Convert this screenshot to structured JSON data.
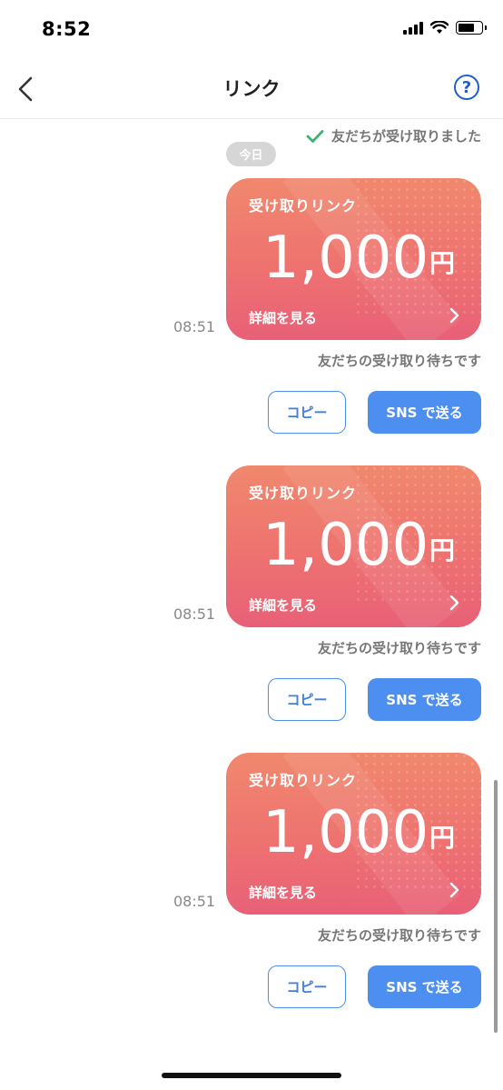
{
  "status_bar": {
    "time": "8:52"
  },
  "header": {
    "title": "リンク",
    "help_icon_label": "?"
  },
  "received_note": "友だちが受け取りました",
  "date_chip": "今日",
  "messages": [
    {
      "timestamp": "08:51",
      "card_title": "受け取りリンク",
      "amount": "1,000",
      "currency": "円",
      "detail_label": "詳細を見る",
      "status": "友だちの受け取り待ちです",
      "copy_label": "コピー",
      "sns_label": "SNS で送る"
    },
    {
      "timestamp": "08:51",
      "card_title": "受け取りリンク",
      "amount": "1,000",
      "currency": "円",
      "detail_label": "詳細を見る",
      "status": "友だちの受け取り待ちです",
      "copy_label": "コピー",
      "sns_label": "SNS で送る"
    },
    {
      "timestamp": "08:51",
      "card_title": "受け取りリンク",
      "amount": "1,000",
      "currency": "円",
      "detail_label": "詳細を見る",
      "status": "友だちの受け取り待ちです",
      "copy_label": "コピー",
      "sns_label": "SNS で送る"
    }
  ],
  "colors": {
    "accent": "#4d8ff0",
    "card_top": "#f0886d",
    "card_bottom": "#e86077",
    "check": "#3cb371",
    "help": "#1f5fc8"
  }
}
